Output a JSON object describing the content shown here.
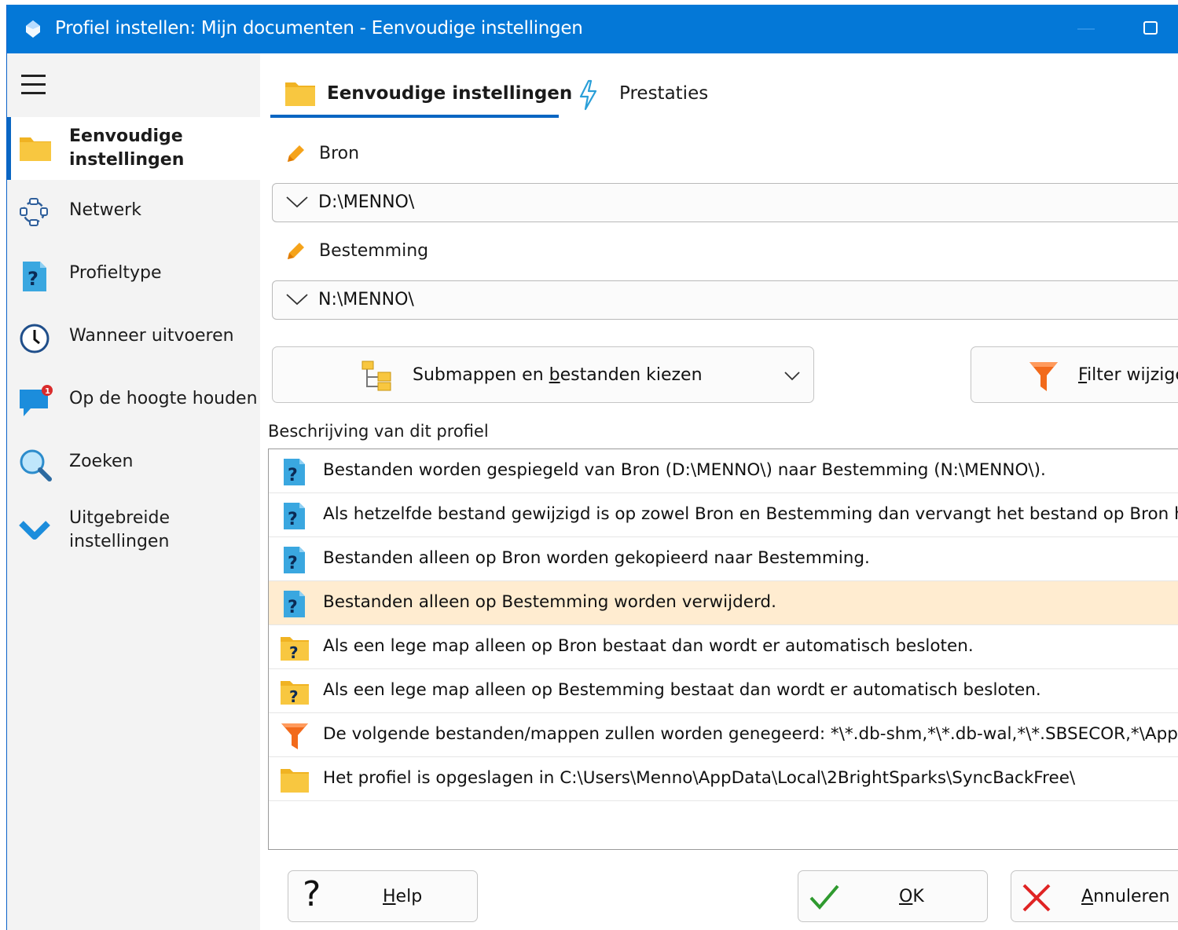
{
  "window": {
    "title": "Profiel instellen: Mijn documenten - Eenvoudige instellingen"
  },
  "sidebar": {
    "items": [
      {
        "line1": "Eenvoudige",
        "line2": "instellingen",
        "icon": "folder-icon"
      },
      {
        "line1": "Netwerk",
        "icon": "network-icon"
      },
      {
        "line1": "Profieltype",
        "icon": "help-document-icon"
      },
      {
        "line1": "Wanneer uitvoeren",
        "icon": "clock-icon"
      },
      {
        "line1": "Op de hoogte houden",
        "icon": "notification-icon",
        "badge": "1"
      },
      {
        "line1": "Zoeken",
        "icon": "search-icon"
      },
      {
        "line1": "Uitgebreide",
        "line2": "instellingen",
        "icon": "chevron-down-icon"
      }
    ]
  },
  "tabs": [
    {
      "label": "Eenvoudige instellingen",
      "icon": "folder-icon"
    },
    {
      "label": "Prestaties",
      "icon": "lightning-icon"
    }
  ],
  "source": {
    "label": "Bron",
    "value": "D:\\MENNO\\"
  },
  "destination": {
    "label": "Bestemming",
    "value": "N:\\MENNO\\"
  },
  "buttons": {
    "choose_pre": "Submappen en ",
    "choose_ul": "b",
    "choose_post": "estanden kiezen",
    "filter_ul": "F",
    "filter_post": "ilter wijzige",
    "help_ul": "H",
    "help_post": "elp",
    "ok_ul": "O",
    "ok_post": "K",
    "cancel_ul": "A",
    "cancel_post": "nnuleren"
  },
  "description": {
    "label": "Beschrijving van dit profiel",
    "rows": [
      {
        "text": "Bestanden worden gespiegeld van Bron (D:\\MENNO\\) naar Bestemming (N:\\MENNO\\).",
        "icon": "help-document-icon"
      },
      {
        "text": "Als hetzelfde bestand gewijzigd is op zowel Bron en Bestemming dan vervangt het bestand op Bron het",
        "icon": "help-document-icon"
      },
      {
        "text": "Bestanden alleen op Bron worden gekopieerd naar Bestemming.",
        "icon": "help-document-icon"
      },
      {
        "text": "Bestanden alleen op Bestemming worden verwijderd.",
        "icon": "help-document-icon"
      },
      {
        "text": "Als een lege map alleen op Bron bestaat dan wordt er automatisch besloten.",
        "icon": "help-folder-icon"
      },
      {
        "text": "Als een lege map alleen op Bestemming bestaat dan wordt er automatisch besloten.",
        "icon": "help-folder-icon"
      },
      {
        "text": "De volgende bestanden/mappen zullen worden genegeerd: *\\*.db-shm,*\\*.db-wal,*\\*.SBSECOR,*\\AppD",
        "icon": "filter-icon"
      },
      {
        "text": "Het profiel is opgeslagen in C:\\Users\\Menno\\AppData\\Local\\2BrightSparks\\SyncBackFree\\",
        "icon": "folder-icon"
      }
    ]
  },
  "colors": {
    "titlebar": "#0478d7",
    "accent": "#0a66c2",
    "highlight_row": "#ffecd0",
    "folder": "#f8c740"
  }
}
